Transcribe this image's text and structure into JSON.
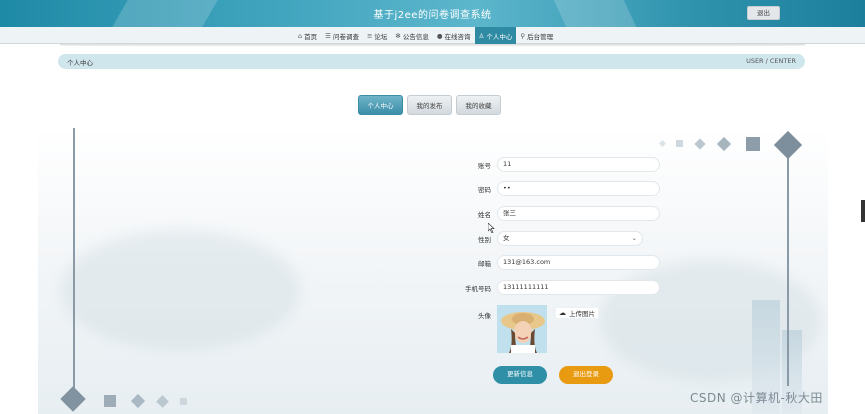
{
  "header": {
    "title": "基于j2ee的问卷调查系统",
    "logout_label": "退出"
  },
  "nav": {
    "items": [
      {
        "icon": "home-icon",
        "label": "首页"
      },
      {
        "icon": "survey-icon",
        "label": "问卷调查"
      },
      {
        "icon": "forum-icon",
        "label": "论坛"
      },
      {
        "icon": "notice-icon",
        "label": "公告信息"
      },
      {
        "icon": "consult-icon",
        "label": "在线咨询"
      },
      {
        "icon": "user-icon",
        "label": "个人中心",
        "active": true
      },
      {
        "icon": "admin-icon",
        "label": "后台管理"
      }
    ]
  },
  "breadcrumb": {
    "left": "个人中心",
    "right": "USER / CENTER"
  },
  "tabs": [
    {
      "label": "个人中心",
      "active": true
    },
    {
      "label": "我的发布",
      "active": false
    },
    {
      "label": "我的收藏",
      "active": false
    }
  ],
  "form": {
    "account_label": "账号",
    "account_value": "11",
    "password_label": "密码",
    "password_value": "••",
    "name_label": "姓名",
    "name_value": "张三",
    "gender_label": "性别",
    "gender_value": "女",
    "email_label": "邮箱",
    "email_value": "131@163.com",
    "phone_label": "手机号码",
    "phone_value": "13111111111",
    "avatar_label": "头像",
    "upload_label": "上传图片"
  },
  "buttons": {
    "update_label": "更新信息",
    "exit_label": "退出登录"
  },
  "watermark": "CSDN @计算机-秋大田",
  "colors": {
    "accent": "#2f8aa3",
    "exit_button": "#e89a10",
    "breadcrumb_bg": "#cfe6ec"
  }
}
